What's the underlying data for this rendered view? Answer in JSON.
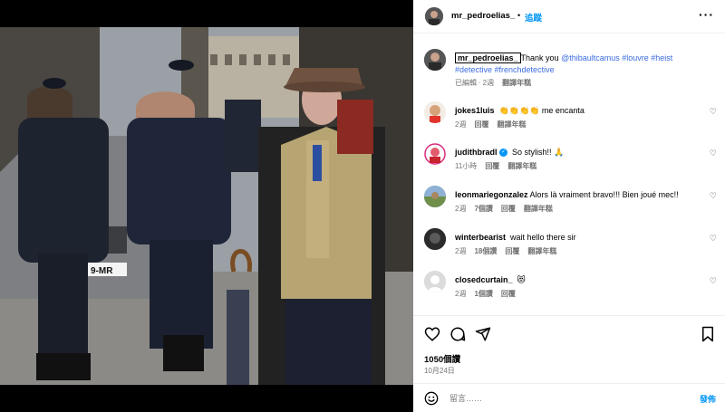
{
  "post_header": {
    "username": "mr_pedroelias_",
    "separator": "•",
    "follow_label": "追蹤",
    "more_label": "···"
  },
  "caption": {
    "username": "mr_pedroelias_",
    "text_before": "Thank you ",
    "mention": "@thibaultcamus",
    "hashtags_line1": " #louvre #heist",
    "hashtags_line2": "#detective #frenchdetective",
    "edited": "已編輯",
    "separator": "·",
    "time": "2週",
    "translate": "翻譯年糕"
  },
  "comments": [
    {
      "username": "jokes1luis",
      "text": "👏👏👏👏 me encanta",
      "time": "2週",
      "reply": "回覆",
      "translate": "翻譯年糕",
      "likes": ""
    },
    {
      "username": "judithbradl",
      "verified": true,
      "text": "So stylish!! 🙏",
      "time": "11小時",
      "reply": "回覆",
      "translate": "翻譯年糕",
      "likes": ""
    },
    {
      "username": "leonmariegonzalez",
      "text": "Alors là vraiment bravo!!! Bien joué mec!!",
      "time": "2週",
      "likes": "7個讚",
      "reply": "回覆",
      "translate": "翻譯年糕"
    },
    {
      "username": "winterbearist",
      "text": "wait hello there sir",
      "time": "2週",
      "likes": "18個讚",
      "reply": "回覆",
      "translate": "翻譯年糕"
    },
    {
      "username": "closedcurtain_",
      "text": "😻",
      "time": "2週",
      "likes": "1個讚",
      "reply": "回覆",
      "translate": ""
    }
  ],
  "actions": {
    "likes": "1050個讚",
    "date": "10月24日"
  },
  "add_comment": {
    "placeholder": "留言……",
    "post_label": "發佈"
  },
  "colors": {
    "accent": "#0095f6",
    "hashtag": "#3b6be0",
    "muted": "#737373"
  },
  "icons": [
    "emoji-icon",
    "heart-icon",
    "comment-icon",
    "share-icon",
    "bookmark-icon",
    "more-icon"
  ]
}
